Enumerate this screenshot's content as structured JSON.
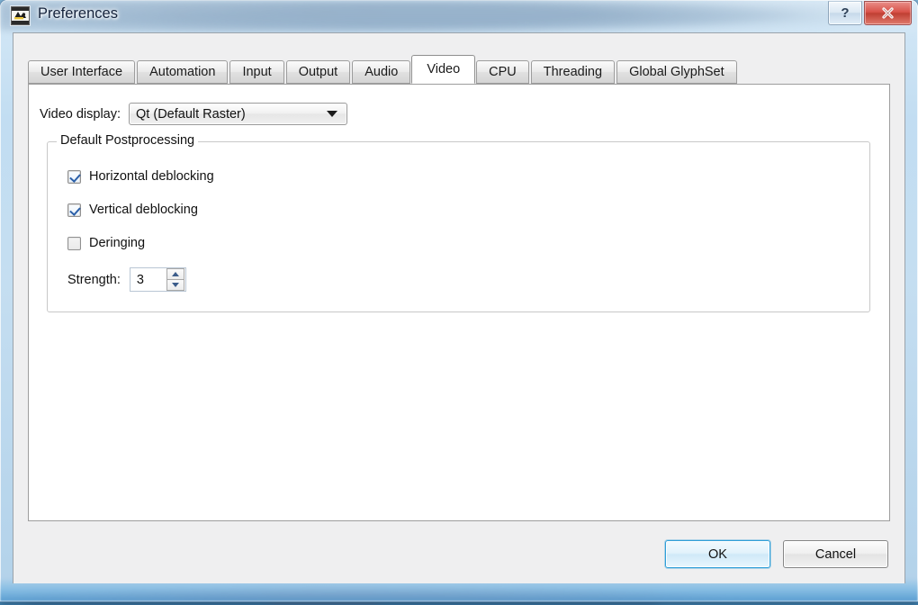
{
  "window": {
    "title": "Preferences",
    "icon": "app-icon",
    "controls": [
      {
        "name": "help",
        "glyph": "?"
      },
      {
        "name": "close",
        "glyph": "×"
      }
    ]
  },
  "tabs": [
    {
      "label": "User Interface",
      "active": false
    },
    {
      "label": "Automation",
      "active": false
    },
    {
      "label": "Input",
      "active": false
    },
    {
      "label": "Output",
      "active": false
    },
    {
      "label": "Audio",
      "active": false
    },
    {
      "label": "Video",
      "active": true
    },
    {
      "label": "CPU",
      "active": false
    },
    {
      "label": "Threading",
      "active": false
    },
    {
      "label": "Global GlyphSet",
      "active": false
    }
  ],
  "video_tab": {
    "display": {
      "label": "Video display:",
      "value": "Qt (Default Raster)",
      "options": [
        "Qt (Default Raster)"
      ]
    },
    "postprocessing": {
      "title": "Default Postprocessing",
      "checkboxes": [
        {
          "label": "Horizontal deblocking",
          "checked": true
        },
        {
          "label": "Vertical deblocking",
          "checked": true
        },
        {
          "label": "Deringing",
          "checked": false
        }
      ],
      "strength": {
        "label": "Strength:",
        "value": "3"
      }
    }
  },
  "footer": {
    "ok_label": "OK",
    "cancel_label": "Cancel"
  },
  "colors": {
    "accent": "#2f9fd8",
    "glass": "#d2e6f6",
    "dialog_bg": "#efeff0",
    "panel_bg": "#ffffff",
    "close_red": "#d9534a"
  }
}
